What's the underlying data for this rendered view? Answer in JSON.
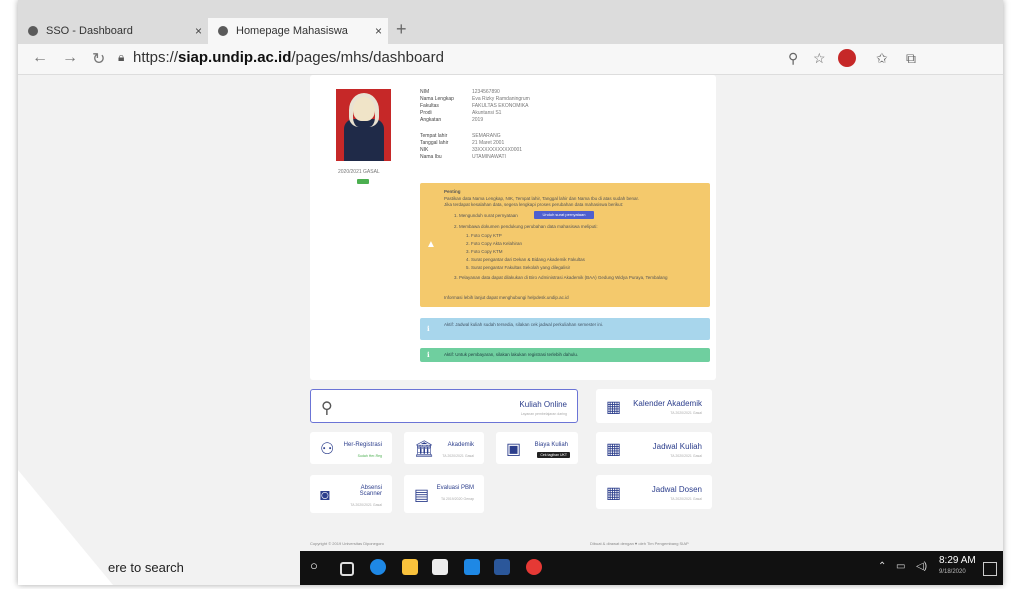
{
  "browser": {
    "tabs": [
      {
        "label": "SSO - Dashboard",
        "close": "×"
      },
      {
        "label": "Homepage Mahasiswa",
        "close": "×"
      }
    ],
    "new_tab": "+",
    "url_prefix": "https://",
    "url_domain": "siap.undip.ac.id",
    "url_path": "/pages/mhs/dashboard"
  },
  "profile": {
    "period": "2020/2021 GASAL",
    "fields": [
      {
        "label": "NIM",
        "value": "1234567890"
      },
      {
        "label": "Nama Lengkap",
        "value": "Eva Rizky Ramdaningrum"
      },
      {
        "label": "Fakultas",
        "value": "FAKULTAS EKONOMIKA"
      },
      {
        "label": "Prodi",
        "value": "Akuntansi S1"
      },
      {
        "label": "Angkatan",
        "value": "2019"
      }
    ],
    "fields2": [
      {
        "label": "Tempat lahir",
        "value": "SEMARANG"
      },
      {
        "label": "Tanggal lahir",
        "value": "21 Maret 2001"
      },
      {
        "label": "NIK",
        "value": "33XXXXXXXXXX0001"
      },
      {
        "label": "Nama Ibu",
        "value": "UTAMINAWATI"
      }
    ]
  },
  "warning": {
    "title": "Penting",
    "lines": [
      "Pastikan data Nama Lengkap, NIK, Tempat lahir, Tanggal lahir dan Nama Ibu di atas sudah benar.",
      "Jika terdapat kesalahan data, segera lengkapi proses perubahan data mahasiswa berikut:",
      "1. Mengunduh surat pernyataan",
      "2. Membawa dokumen pendukung perubahan data mahasiswa meliputi:",
      "1. Foto Copy KTP",
      "2. Foto Copy Akta Kelahiran",
      "3. Foto Copy KTM",
      "4. Surat pengantar dari Dekan & Bidang Akademik Fakultas",
      "5. Surat pengantar Fakultas Sekolah yang dilegalisir",
      "3. Pelayanan data dapat dilakukan di Biro Administrasi Akademik (BAA) Gedung Widya Puraya, Tembalang",
      "Informasi lebih lanjut dapat menghubungi helpdesk.undip.ac.id"
    ],
    "download_label": "Unduh surat pernyataan"
  },
  "notice1": "Aktif: Jadwal kuliah sudah tersedia, silakan cek jadwal perkuliahan semester ini.",
  "notice2": "Aktif: Untuk pembayaran, silakan lakukan registrasi terlebih dahulu.",
  "tiles": {
    "kuliah_online": {
      "title": "Kuliah Online",
      "sub": "Layanan pembelajaran daring"
    },
    "kalender": {
      "title": "Kalender Akademik",
      "sub": "TA 2020/2021 Gasal"
    },
    "her": {
      "title": "Her-Registrasi",
      "sub": "Sudah Her-Reg"
    },
    "akademik": {
      "title": "Akademik",
      "sub": "TA 2020/2021 Gasal"
    },
    "biaya": {
      "title": "Biaya Kuliah",
      "badge": "Cek tagihan UKT"
    },
    "jadwal_kuliah": {
      "title": "Jadwal Kuliah",
      "sub": "TA 2020/2021 Gasal"
    },
    "absensi": {
      "title": "Absensi Scanner",
      "sub": "TA 2020/2021 Gasal"
    },
    "evaluasi": {
      "title": "Evaluasi PBM",
      "sub": "TA 2019/2020 Genap"
    },
    "jadwal_dosen": {
      "title": "Jadwal Dosen",
      "sub": "TA 2020/2021 Gasal"
    }
  },
  "footer": {
    "left": "Copyright © 2019 Universitas Diponegoro",
    "right": "Dibuat & dirawat dengan ♥ oleh Tim Pengembang SIAP"
  },
  "taskbar": {
    "search": "ere to search",
    "time": "8:29 AM",
    "date": "9/18/2020"
  }
}
